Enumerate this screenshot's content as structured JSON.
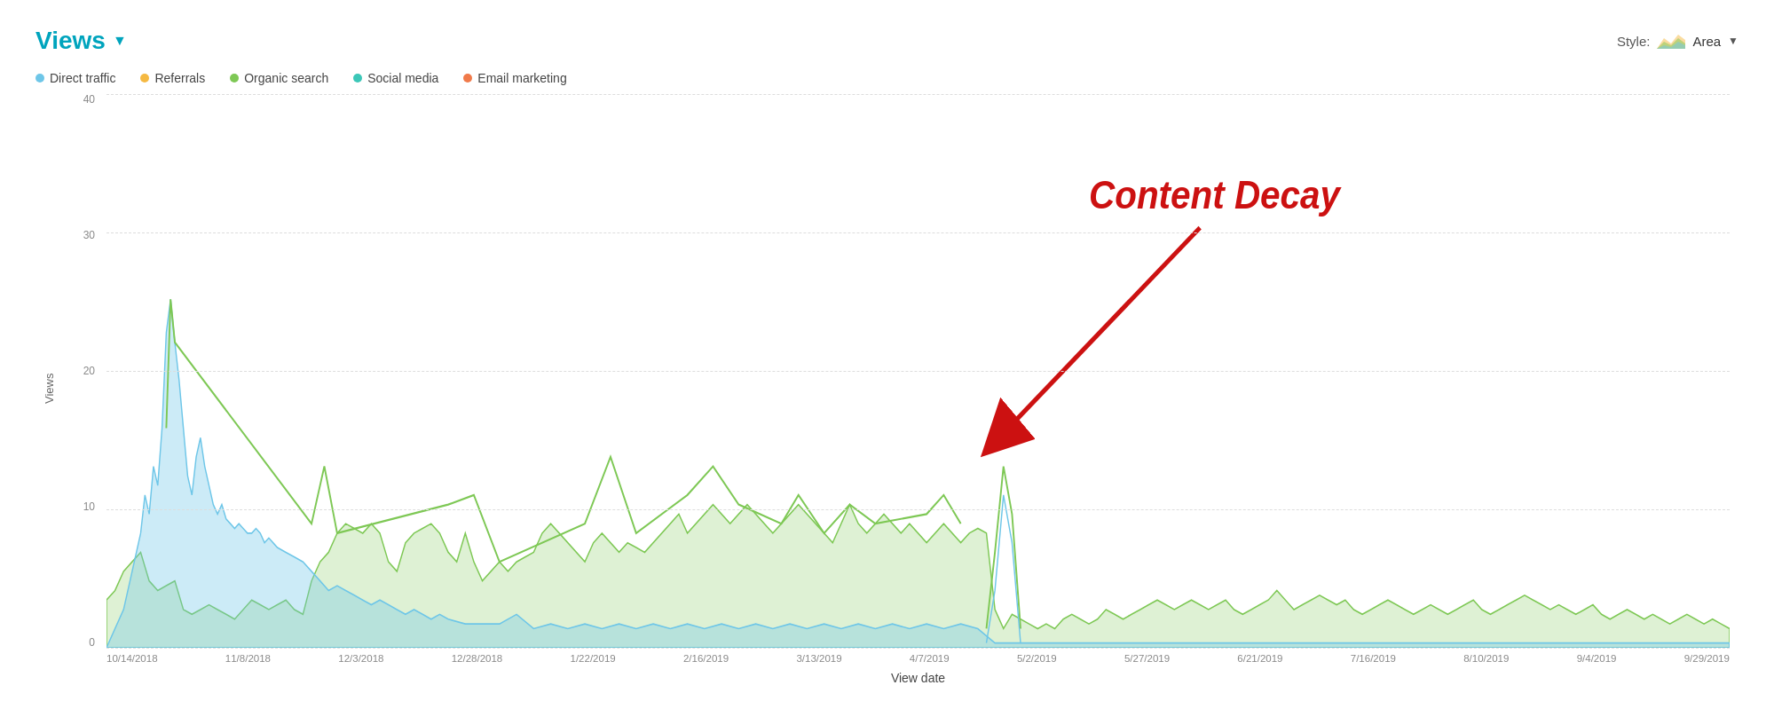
{
  "header": {
    "title": "Views",
    "title_dropdown_icon": "▼",
    "style_label": "Style:",
    "chart_style": "Area",
    "chart_style_dropdown": "▼"
  },
  "legend": {
    "items": [
      {
        "label": "Direct traffic",
        "color": "#6ec6e8"
      },
      {
        "label": "Referrals",
        "color": "#f5b942"
      },
      {
        "label": "Organic search",
        "color": "#7ec855"
      },
      {
        "label": "Social media",
        "color": "#3cc7b8"
      },
      {
        "label": "Email marketing",
        "color": "#f07a4a"
      }
    ]
  },
  "yaxis": {
    "label": "Views",
    "ticks": [
      0,
      10,
      20,
      30,
      40
    ]
  },
  "xaxis": {
    "label": "View date",
    "ticks": [
      "10/14/2018",
      "11/8/2018",
      "12/3/2018",
      "12/28/2018",
      "1/22/2019",
      "2/16/2019",
      "3/13/2019",
      "4/7/2019",
      "5/2/2019",
      "5/27/2019",
      "6/21/2019",
      "7/16/2019",
      "8/10/2019",
      "9/4/2019",
      "9/29/2019"
    ]
  },
  "annotation": {
    "label": "Content Decay"
  }
}
